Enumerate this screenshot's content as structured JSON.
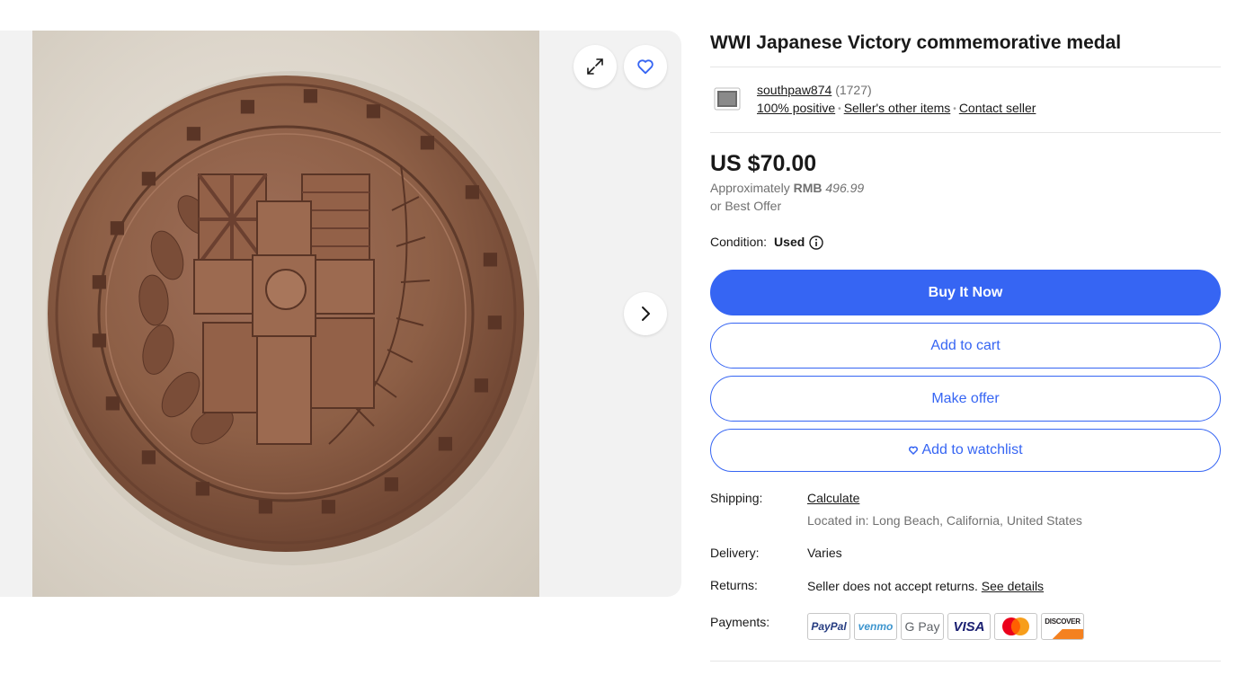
{
  "listing": {
    "title": "WWI Japanese Victory commemorative medal"
  },
  "gallery": {
    "image_alt": "Bronze commemorative medal",
    "expand_icon": "expand-icon",
    "watch_icon": "heart-icon",
    "next_icon": "chevron-right-icon"
  },
  "seller": {
    "name": "southpaw874",
    "feedback_count": "(1727)",
    "positive": "100% positive",
    "other_items": "Seller's other items",
    "contact": "Contact seller"
  },
  "pricing": {
    "price": "US $70.00",
    "approx_label": "Approximately",
    "approx_currency": "RMB",
    "approx_value": "496.99",
    "best_offer": "or Best Offer"
  },
  "condition": {
    "label": "Condition:",
    "value": "Used",
    "icon": "info-icon"
  },
  "actions": {
    "buy_now": "Buy It Now",
    "add_to_cart": "Add to cart",
    "make_offer": "Make offer",
    "watchlist": "Add to watchlist"
  },
  "details": {
    "shipping_label": "Shipping:",
    "shipping_value": "Calculate",
    "location": "Located in: Long Beach, California, United States",
    "delivery_label": "Delivery:",
    "delivery_value": "Varies",
    "returns_label": "Returns:",
    "returns_value": "Seller does not accept returns.",
    "returns_link": "See details",
    "payments_label": "Payments:"
  },
  "payments": [
    "PayPal",
    "venmo",
    "G Pay",
    "VISA",
    "Mastercard",
    "DISCOVER"
  ],
  "colors": {
    "accent": "#3665f3",
    "text": "#191919",
    "muted": "#707070",
    "medal": "#8a5a3f"
  }
}
